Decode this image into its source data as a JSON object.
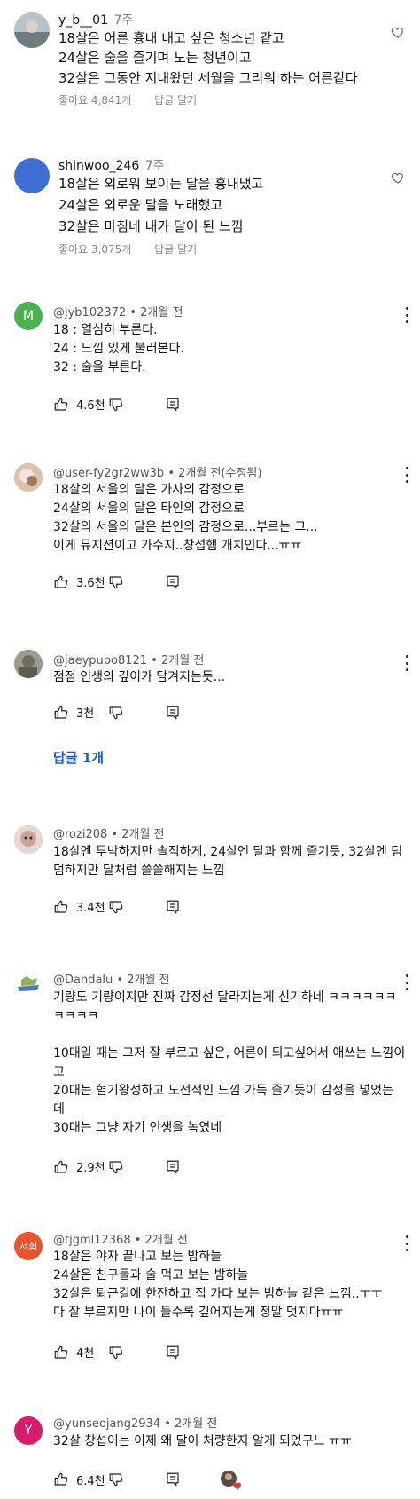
{
  "ig_comments": [
    {
      "username": "y_b__01",
      "time": "7주",
      "lines": [
        "18살은 어른 흉내 내고 싶은 청소년 같고",
        "24살은 술을 즐기며 노는 청년이고",
        "32살은 그동안 지내왔던 세월을 그리워 하는 어른같다"
      ],
      "likes": "좋아요 4,841개",
      "reply": "답글 달기"
    },
    {
      "username": "shinwoo_246",
      "time": "7주",
      "lines": [
        "18살은 외로워 보이는 달을 흉내냈고",
        "24살은 외로운 달을 노래했고",
        "32살은 마침네 내가 달이 된 느낌"
      ],
      "likes": "좋아요 3,075개",
      "reply": "답글 달기"
    }
  ],
  "yt_comments": [
    {
      "avatar_letter": "M",
      "avatar_color": "#4caf50",
      "handle": "@jyb102372",
      "meta": "• 2개월 전",
      "lines": [
        "18 : 열심히 부른다.",
        "24 : 느낌 있게 불러본다.",
        "32 : 술을 부른다."
      ],
      "likes": "4.6천"
    },
    {
      "avatar_letter": "",
      "avatar_color": "#c9a98a",
      "handle": "@user-fy2gr2ww3b",
      "meta": "• 2개월 전(수정됨)",
      "lines": [
        "18살의 서울의 달은 가사의 감정으로",
        "24살의 서울의 달은 타인의 감정으로",
        "32살의 서울의 달은 본인의 감정으로...부르는 그...",
        "이게 뮤지션이고 가수지..창섭햄 개치인다...ㅠㅠ"
      ],
      "likes": "3.6천"
    },
    {
      "avatar_letter": "",
      "avatar_color": "#8a8f7a",
      "handle": "@jaeypupo8121",
      "meta": "• 2개월 전",
      "lines": [
        "점점 인생의 깊이가 담겨지는듯..."
      ],
      "likes": "3천",
      "replies": "답글 1개"
    },
    {
      "avatar_letter": "",
      "avatar_color": "#c7a7a0",
      "handle": "@rozi208",
      "meta": "• 2개월 전",
      "lines": [
        "18살엔 투박하지만 솔직하게, 24살엔 달과 함께 즐기듯, 32살엔 덤",
        "덤하지만 달처럼 쓸쓸해지는 느낌"
      ],
      "likes": "3.4천"
    },
    {
      "avatar_letter": "",
      "avatar_color": "#ffffff",
      "handle": "@Dandalu",
      "meta": "• 2개월 전",
      "lines": [
        "기량도 기량이지만 진짜 감정선 달라지는게 신기하네 ㅋㅋㅋㅋㅋㅋ",
        "ㅋㅋㅋㅋ",
        "",
        "10대일 때는 그저 잘 부르고 싶은, 어른이 되고싶어서 애쓰는 느낌이",
        "고",
        "20대는 혈기왕성하고 도전적인 느낌 가득 즐기듯이 감정을 넣었는",
        "데",
        "30대는 그냥 자기 인생을 녹였네"
      ],
      "likes": "2.9천"
    },
    {
      "avatar_letter": "서희",
      "avatar_color": "#e9542f",
      "handle": "@tjgml12368",
      "meta": "• 2개월 전",
      "lines": [
        "18살은 야자 끝나고 보는 밤하늘",
        "24살은 친구들과 술 먹고 보는 밤하늘",
        "32살은 퇴근길에 한잔하고 집 가다 보는 밤하늘 같은 느낌..ㅜㅜ",
        "다 잘 부르지만 나이 들수록 깊어지는게 정말 멋지다ㅠㅠ"
      ],
      "likes": "4천"
    },
    {
      "avatar_letter": "Y",
      "avatar_color": "#d81b6a",
      "handle": "@yunseojang2934",
      "meta": "• 2개월 전",
      "lines": [
        "32살 창섭이는 이제 왜 달이 처량한지 알게 되었구느 ㅠㅠ"
      ],
      "likes": "6.4천"
    }
  ]
}
